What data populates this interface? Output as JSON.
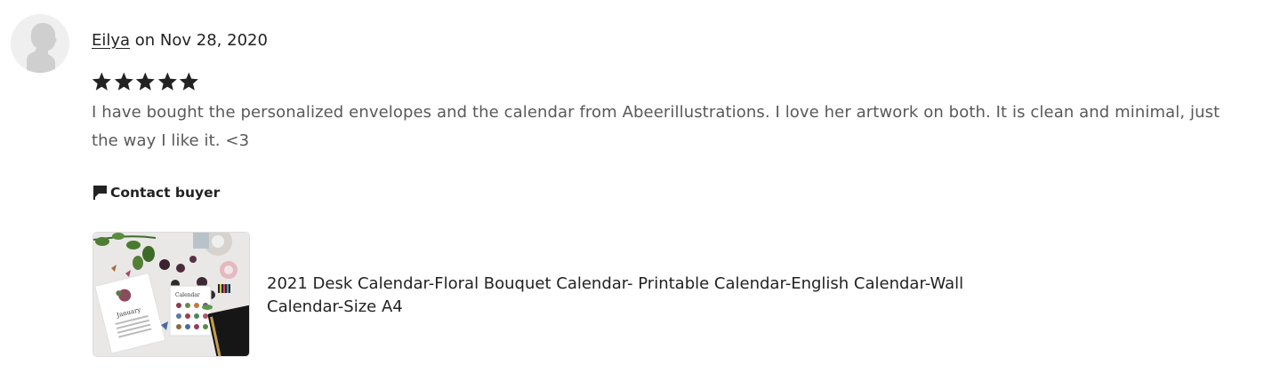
{
  "review": {
    "author": "Eilya",
    "date_text": " on Nov 28, 2020",
    "rating": 5,
    "rating_max": 5,
    "star_color": "#222222",
    "text": "I have bought the personalized envelopes and the calendar from Abeerillustrations. I love her artwork on both. It is clean and minimal, just the way I like it. <3"
  },
  "actions": {
    "contact_label": "Contact buyer",
    "contact_icon": "speech-flag-icon"
  },
  "listing": {
    "title": "2021 Desk Calendar-Floral Bouquet Calendar- Printable Calendar-English Calendar-Wall Calendar-Size A4",
    "image_label": "January"
  },
  "avatar": {
    "icon": "default-user-silhouette-icon"
  }
}
